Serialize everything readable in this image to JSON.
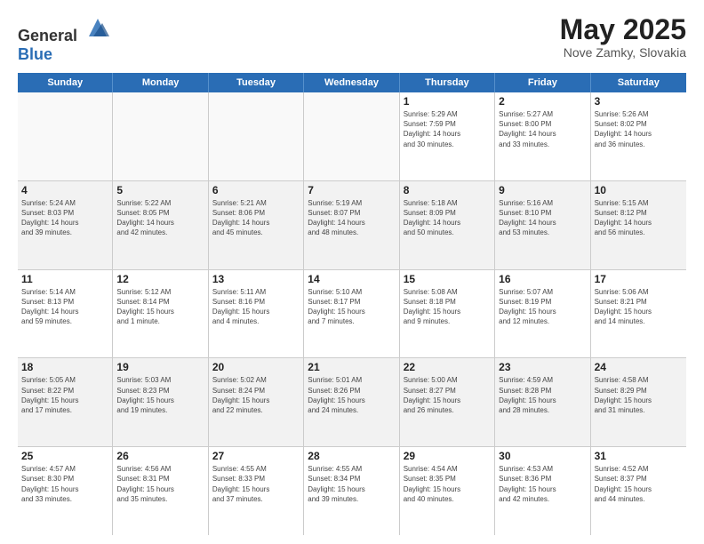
{
  "header": {
    "logo_general": "General",
    "logo_blue": "Blue",
    "month_year": "May 2025",
    "location": "Nove Zamky, Slovakia"
  },
  "days_of_week": [
    "Sunday",
    "Monday",
    "Tuesday",
    "Wednesday",
    "Thursday",
    "Friday",
    "Saturday"
  ],
  "weeks": [
    [
      {
        "day": "",
        "info": "",
        "empty": true
      },
      {
        "day": "",
        "info": "",
        "empty": true
      },
      {
        "day": "",
        "info": "",
        "empty": true
      },
      {
        "day": "",
        "info": "",
        "empty": true
      },
      {
        "day": "1",
        "info": "Sunrise: 5:29 AM\nSunset: 7:59 PM\nDaylight: 14 hours\nand 30 minutes.",
        "empty": false
      },
      {
        "day": "2",
        "info": "Sunrise: 5:27 AM\nSunset: 8:00 PM\nDaylight: 14 hours\nand 33 minutes.",
        "empty": false
      },
      {
        "day": "3",
        "info": "Sunrise: 5:26 AM\nSunset: 8:02 PM\nDaylight: 14 hours\nand 36 minutes.",
        "empty": false
      }
    ],
    [
      {
        "day": "4",
        "info": "Sunrise: 5:24 AM\nSunset: 8:03 PM\nDaylight: 14 hours\nand 39 minutes.",
        "empty": false
      },
      {
        "day": "5",
        "info": "Sunrise: 5:22 AM\nSunset: 8:05 PM\nDaylight: 14 hours\nand 42 minutes.",
        "empty": false
      },
      {
        "day": "6",
        "info": "Sunrise: 5:21 AM\nSunset: 8:06 PM\nDaylight: 14 hours\nand 45 minutes.",
        "empty": false
      },
      {
        "day": "7",
        "info": "Sunrise: 5:19 AM\nSunset: 8:07 PM\nDaylight: 14 hours\nand 48 minutes.",
        "empty": false
      },
      {
        "day": "8",
        "info": "Sunrise: 5:18 AM\nSunset: 8:09 PM\nDaylight: 14 hours\nand 50 minutes.",
        "empty": false
      },
      {
        "day": "9",
        "info": "Sunrise: 5:16 AM\nSunset: 8:10 PM\nDaylight: 14 hours\nand 53 minutes.",
        "empty": false
      },
      {
        "day": "10",
        "info": "Sunrise: 5:15 AM\nSunset: 8:12 PM\nDaylight: 14 hours\nand 56 minutes.",
        "empty": false
      }
    ],
    [
      {
        "day": "11",
        "info": "Sunrise: 5:14 AM\nSunset: 8:13 PM\nDaylight: 14 hours\nand 59 minutes.",
        "empty": false
      },
      {
        "day": "12",
        "info": "Sunrise: 5:12 AM\nSunset: 8:14 PM\nDaylight: 15 hours\nand 1 minute.",
        "empty": false
      },
      {
        "day": "13",
        "info": "Sunrise: 5:11 AM\nSunset: 8:16 PM\nDaylight: 15 hours\nand 4 minutes.",
        "empty": false
      },
      {
        "day": "14",
        "info": "Sunrise: 5:10 AM\nSunset: 8:17 PM\nDaylight: 15 hours\nand 7 minutes.",
        "empty": false
      },
      {
        "day": "15",
        "info": "Sunrise: 5:08 AM\nSunset: 8:18 PM\nDaylight: 15 hours\nand 9 minutes.",
        "empty": false
      },
      {
        "day": "16",
        "info": "Sunrise: 5:07 AM\nSunset: 8:19 PM\nDaylight: 15 hours\nand 12 minutes.",
        "empty": false
      },
      {
        "day": "17",
        "info": "Sunrise: 5:06 AM\nSunset: 8:21 PM\nDaylight: 15 hours\nand 14 minutes.",
        "empty": false
      }
    ],
    [
      {
        "day": "18",
        "info": "Sunrise: 5:05 AM\nSunset: 8:22 PM\nDaylight: 15 hours\nand 17 minutes.",
        "empty": false
      },
      {
        "day": "19",
        "info": "Sunrise: 5:03 AM\nSunset: 8:23 PM\nDaylight: 15 hours\nand 19 minutes.",
        "empty": false
      },
      {
        "day": "20",
        "info": "Sunrise: 5:02 AM\nSunset: 8:24 PM\nDaylight: 15 hours\nand 22 minutes.",
        "empty": false
      },
      {
        "day": "21",
        "info": "Sunrise: 5:01 AM\nSunset: 8:26 PM\nDaylight: 15 hours\nand 24 minutes.",
        "empty": false
      },
      {
        "day": "22",
        "info": "Sunrise: 5:00 AM\nSunset: 8:27 PM\nDaylight: 15 hours\nand 26 minutes.",
        "empty": false
      },
      {
        "day": "23",
        "info": "Sunrise: 4:59 AM\nSunset: 8:28 PM\nDaylight: 15 hours\nand 28 minutes.",
        "empty": false
      },
      {
        "day": "24",
        "info": "Sunrise: 4:58 AM\nSunset: 8:29 PM\nDaylight: 15 hours\nand 31 minutes.",
        "empty": false
      }
    ],
    [
      {
        "day": "25",
        "info": "Sunrise: 4:57 AM\nSunset: 8:30 PM\nDaylight: 15 hours\nand 33 minutes.",
        "empty": false
      },
      {
        "day": "26",
        "info": "Sunrise: 4:56 AM\nSunset: 8:31 PM\nDaylight: 15 hours\nand 35 minutes.",
        "empty": false
      },
      {
        "day": "27",
        "info": "Sunrise: 4:55 AM\nSunset: 8:33 PM\nDaylight: 15 hours\nand 37 minutes.",
        "empty": false
      },
      {
        "day": "28",
        "info": "Sunrise: 4:55 AM\nSunset: 8:34 PM\nDaylight: 15 hours\nand 39 minutes.",
        "empty": false
      },
      {
        "day": "29",
        "info": "Sunrise: 4:54 AM\nSunset: 8:35 PM\nDaylight: 15 hours\nand 40 minutes.",
        "empty": false
      },
      {
        "day": "30",
        "info": "Sunrise: 4:53 AM\nSunset: 8:36 PM\nDaylight: 15 hours\nand 42 minutes.",
        "empty": false
      },
      {
        "day": "31",
        "info": "Sunrise: 4:52 AM\nSunset: 8:37 PM\nDaylight: 15 hours\nand 44 minutes.",
        "empty": false
      }
    ]
  ]
}
